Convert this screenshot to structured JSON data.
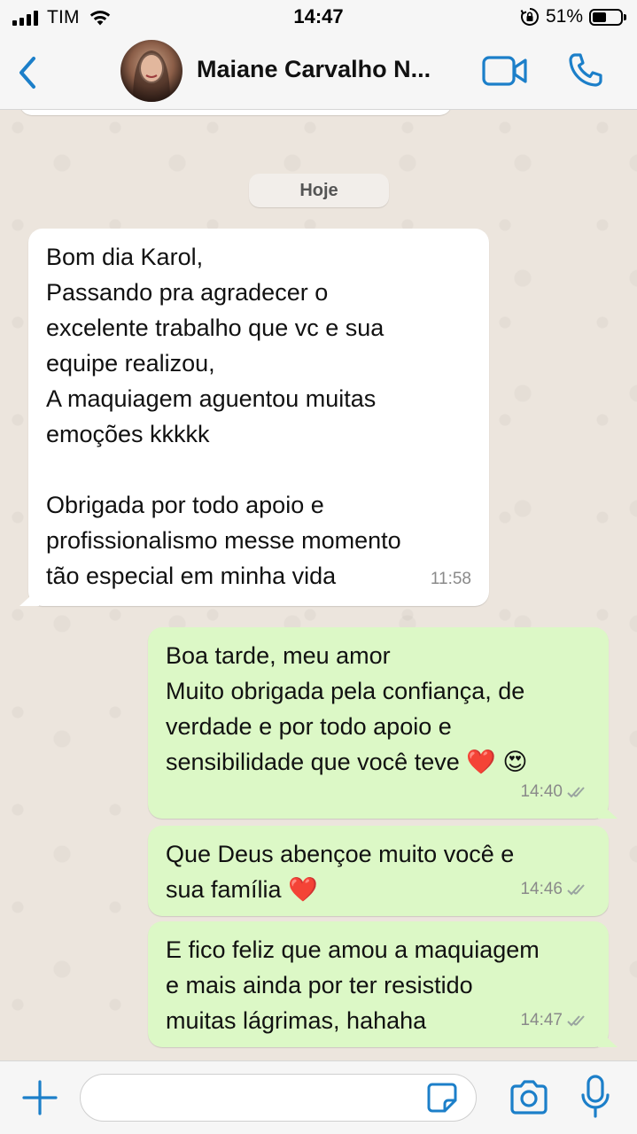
{
  "status_bar": {
    "carrier": "TIM",
    "time": "14:47",
    "battery_percent": "51%",
    "battery_level": 0.51,
    "icons": [
      "signal-icon",
      "wifi-icon",
      "rotation-lock-icon",
      "battery-icon"
    ]
  },
  "header": {
    "back_icon": "chevron-left-icon",
    "contact_name": "Maiane Carvalho N...",
    "video_icon": "video-camera-icon",
    "call_icon": "phone-icon",
    "accent_color": "#1c7fc9"
  },
  "chat": {
    "date_label": "Hoje",
    "messages": [
      {
        "direction": "incoming",
        "text": "Bom dia Karol,\nPassando pra agradecer o\nexcelente trabalho que vc e sua\nequipe realizou,\nA maquiagem aguentou muitas\nemoções kkkkk\n\nObrigada por todo apoio e\nprofissionalismo messe momento\ntão especial em minha vida",
        "time": "11:58"
      },
      {
        "direction": "outgoing",
        "text": "Boa tarde, meu amor\nMuito obrigada pela confiança, de\nverdade e por todo apoio e\nsensibilidade que você teve ❤️ 😍",
        "time": "14:40",
        "status": "read-ticks-icon"
      },
      {
        "direction": "outgoing",
        "text": "Que Deus abençoe muito você e\nsua família ❤️",
        "time": "14:46",
        "status": "read-ticks-icon"
      },
      {
        "direction": "outgoing",
        "text": "E fico feliz que amou a maquiagem\ne mais ainda por ter resistido\nmuitas lágrimas, hahaha",
        "time": "14:47",
        "status": "read-ticks-icon"
      }
    ],
    "incoming_bubble_color": "#ffffff",
    "outgoing_bubble_color": "#dcf8c6"
  },
  "input_bar": {
    "placeholder": "",
    "icons": [
      "plus-icon",
      "sticker-icon",
      "camera-icon",
      "microphone-icon"
    ]
  }
}
